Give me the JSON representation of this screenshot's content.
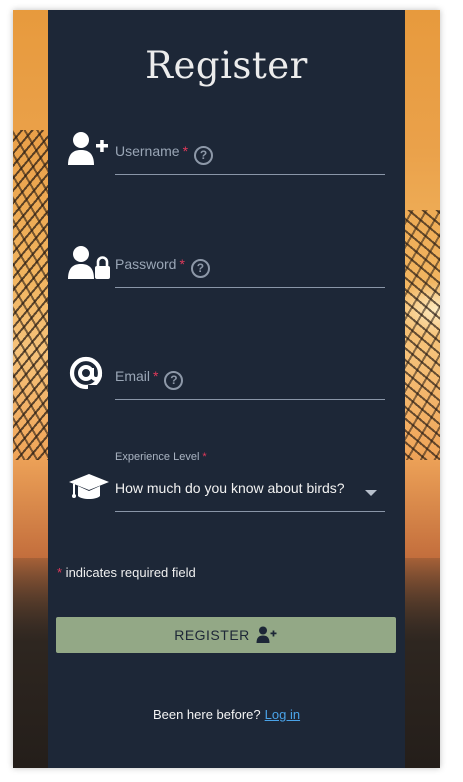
{
  "form": {
    "title": "Register",
    "fields": [
      {
        "label": "Username",
        "required_mark": "*",
        "help": "?",
        "icon": "user-plus-icon"
      },
      {
        "label": "Password",
        "required_mark": "*",
        "help": "?",
        "icon": "user-lock-icon"
      },
      {
        "label": "Email",
        "required_mark": "*",
        "help": "?",
        "icon": "at-icon"
      }
    ],
    "experience": {
      "label": "Experience Level",
      "required_mark": "*",
      "selected": "How much do you know about birds?",
      "icon": "graduation-cap-icon"
    },
    "required_note": {
      "mark": "*",
      "text": " indicates required field"
    },
    "register_button": {
      "label": "REGISTER",
      "icon": "user-plus-icon"
    },
    "login_prompt": {
      "text": "Been here before?",
      "link": "Log in"
    }
  },
  "colors": {
    "panel": "#1d2737",
    "button": "#93a886",
    "required": "#e0395a",
    "link": "#4aa3e8"
  }
}
